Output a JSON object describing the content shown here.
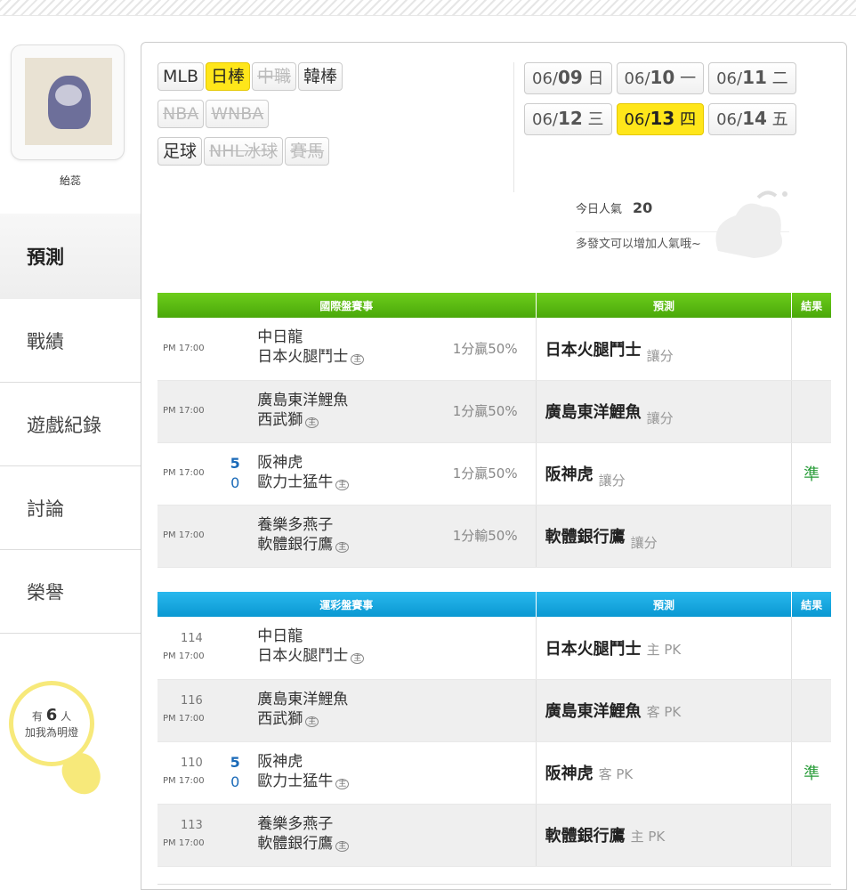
{
  "user": {
    "name": "紿蕊"
  },
  "nav": {
    "items": [
      {
        "label": "預測",
        "active": true
      },
      {
        "label": "戰績",
        "active": false
      },
      {
        "label": "遊戲紀錄",
        "active": false
      },
      {
        "label": "討論",
        "active": false
      },
      {
        "label": "榮譽",
        "active": false
      }
    ]
  },
  "fans": {
    "prefix": "有",
    "count": "6",
    "suffix": "人",
    "line2": "加我為明燈"
  },
  "leagues": [
    {
      "label": "MLB",
      "state": "normal"
    },
    {
      "label": "日棒",
      "state": "on"
    },
    {
      "label": "中職",
      "state": "off"
    },
    {
      "label": "韓棒",
      "state": "normal"
    },
    {
      "label": "NBA",
      "state": "off"
    },
    {
      "label": "WNBA",
      "state": "off"
    },
    {
      "label": "足球",
      "state": "normal"
    },
    {
      "label": "NHL冰球",
      "state": "off"
    },
    {
      "label": "賽馬",
      "state": "off"
    }
  ],
  "dates": [
    {
      "md": "06/",
      "d": "09",
      "wd": "日",
      "on": false
    },
    {
      "md": "06/",
      "d": "10",
      "wd": "一",
      "on": false
    },
    {
      "md": "06/",
      "d": "11",
      "wd": "二",
      "on": false
    },
    {
      "md": "06/",
      "d": "12",
      "wd": "三",
      "on": false
    },
    {
      "md": "06/",
      "d": "13",
      "wd": "四",
      "on": true
    },
    {
      "md": "06/",
      "d": "14",
      "wd": "五",
      "on": false
    }
  ],
  "popularity": {
    "label": "今日人氣",
    "value": "20",
    "hint": "多發文可以增加人氣哦~"
  },
  "intl": {
    "headers": {
      "event": "國際盤賽事",
      "pred": "預測",
      "result": "結果"
    },
    "host_mark": "主",
    "rows": [
      {
        "time": "PM 17:00",
        "s1": "",
        "s2": "",
        "team1": "中日龍",
        "team2": "日本火腿鬥士",
        "host": 2,
        "odds1": "",
        "odds2": "1分贏50%",
        "pred": "日本火腿鬥士",
        "tag": "讓分",
        "result": ""
      },
      {
        "time": "PM 17:00",
        "s1": "",
        "s2": "",
        "team1": "廣島東洋鯉魚",
        "team2": "西武獅",
        "host": 2,
        "odds1": "1分贏50%",
        "odds2": "",
        "pred": "廣島東洋鯉魚",
        "tag": "讓分",
        "result": ""
      },
      {
        "time": "PM 17:00",
        "s1": "5",
        "s2": "0",
        "team1": "阪神虎",
        "team2": "歐力士猛牛",
        "host": 2,
        "odds1": "1分贏50%",
        "odds2": "",
        "pred": "阪神虎",
        "tag": "讓分",
        "result": "準"
      },
      {
        "time": "PM 17:00",
        "s1": "",
        "s2": "",
        "team1": "養樂多燕子",
        "team2": "軟體銀行鷹",
        "host": 2,
        "odds1": "",
        "odds2": "1分輸50%",
        "pred": "軟體銀行鷹",
        "tag": "讓分",
        "result": ""
      }
    ]
  },
  "lottery": {
    "headers": {
      "event": "運彩盤賽事",
      "pred": "預測",
      "result": "結果"
    },
    "host_mark": "主",
    "rows": [
      {
        "no": "114",
        "time": "PM 17:00",
        "s1": "",
        "s2": "",
        "team1": "中日龍",
        "team2": "日本火腿鬥士",
        "pred": "日本火腿鬥士",
        "tag": "主 PK",
        "result": ""
      },
      {
        "no": "116",
        "time": "PM 17:00",
        "s1": "",
        "s2": "",
        "team1": "廣島東洋鯉魚",
        "team2": "西武獅",
        "pred": "廣島東洋鯉魚",
        "tag": "客 PK",
        "result": ""
      },
      {
        "no": "110",
        "time": "PM 17:00",
        "s1": "5",
        "s2": "0",
        "team1": "阪神虎",
        "team2": "歐力士猛牛",
        "pred": "阪神虎",
        "tag": "客 PK",
        "result": "準"
      },
      {
        "no": "113",
        "time": "PM 17:00",
        "s1": "",
        "s2": "",
        "team1": "養樂多燕子",
        "team2": "軟體銀行鷹",
        "pred": "軟體銀行鷹",
        "tag": "主 PK",
        "result": ""
      }
    ]
  },
  "colors": {
    "accent_yellow": "#ffe61a",
    "green_header": "#4aa80a",
    "blue_header": "#0a98d2",
    "result_green": "#2a9d3a"
  }
}
